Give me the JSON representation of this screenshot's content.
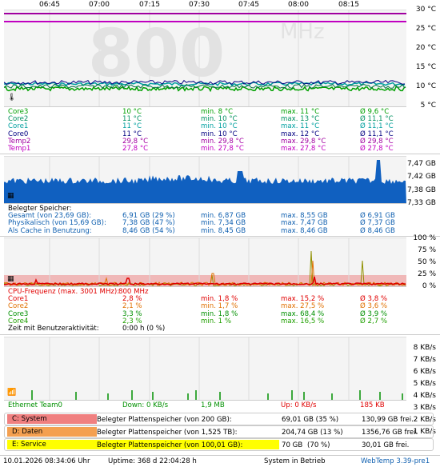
{
  "time_axis": [
    "06:45",
    "07:00",
    "07:15",
    "07:30",
    "07:45",
    "08:00",
    "08:15"
  ],
  "temp_panel": {
    "y_ticks": [
      "30 °C",
      "25 °C",
      "20 °C",
      "15 °C",
      "10 °C",
      "5 °C"
    ],
    "background_text": {
      "value": "800",
      "unit": "MHz"
    },
    "rows": [
      {
        "name": "Core3",
        "cur": "10 °C",
        "min": "min. 8 °C",
        "max": "max. 11 °C",
        "avg": "Ø 9,6 °C",
        "color": "#00a000"
      },
      {
        "name": "Core2",
        "cur": "11 °C",
        "min": "min. 10 °C",
        "max": "max. 13 °C",
        "avg": "Ø 11,1 °C",
        "color": "#009060"
      },
      {
        "name": "Core1",
        "cur": "11 °C",
        "min": "min. 10 °C",
        "max": "max. 11 °C",
        "avg": "Ø 11,1 °C",
        "color": "#00a0a0"
      },
      {
        "name": "Core0",
        "cur": "11 °C",
        "min": "min. 10 °C",
        "max": "max. 12 °C",
        "avg": "Ø 11,1 °C",
        "color": "#000080"
      },
      {
        "name": "Temp2",
        "cur": "29,8 °C",
        "min": "min. 29,8 °C",
        "max": "max. 29,8 °C",
        "avg": "Ø 29,8 °C",
        "color": "#a000a0"
      },
      {
        "name": "Temp1",
        "cur": "27,8 °C",
        "min": "min. 27,8 °C",
        "max": "max. 27,8 °C",
        "avg": "Ø 27,8 °C",
        "color": "#c000c0"
      }
    ]
  },
  "mem_panel": {
    "y_ticks": [
      "7,47 GB",
      "7,42 GB",
      "7,38 GB",
      "7,33 GB"
    ],
    "header": "Belegter Speicher:",
    "rows": [
      {
        "name": "Gesamt (von 23,69 GB):",
        "cur": "6,91 GB (29 %)",
        "min": "min. 6,87 GB",
        "max": "max. 8,55 GB",
        "avg": "Ø 6,91 GB"
      },
      {
        "name": "Physikalisch (von 15,69 GB):",
        "cur": "7,38 GB (47 %)",
        "min": "min. 7,34 GB",
        "max": "max. 7,47 GB",
        "avg": "Ø 7,37 GB"
      },
      {
        "name": "Als Cache in Benutzung:",
        "cur": "8,46 GB (54 %)",
        "min": "min. 8,45 GB",
        "max": "max. 8,46 GB",
        "avg": "Ø 8,46 GB"
      }
    ]
  },
  "cpu_panel": {
    "y_ticks": [
      "100 %",
      "75 %",
      "50 %",
      "25 %",
      "0 %"
    ],
    "freq_label": "CPU-Frequenz (max. 3001 MHz):",
    "freq_value": "800 MHz",
    "rows": [
      {
        "name": "Core1",
        "cur": "2,8 %",
        "min": "min. 1,8 %",
        "max": "max. 15,2 %",
        "avg": "Ø 3,8 %",
        "color": "#e00000"
      },
      {
        "name": "Core2",
        "cur": "2,1 %",
        "min": "min. 1,7 %",
        "max": "max. 27,5 %",
        "avg": "Ø 3,6 %",
        "color": "#e07000"
      },
      {
        "name": "Core3",
        "cur": "3,3 %",
        "min": "min. 1,8 %",
        "max": "max. 68,4 %",
        "avg": "Ø 3,9 %",
        "color": "#009000"
      },
      {
        "name": "Core4",
        "cur": "2,3 %",
        "min": "min. 1 %",
        "max": "max. 16,5 %",
        "avg": "Ø 2,7 %",
        "color": "#20a000"
      }
    ],
    "activity_label": "Zeit mit Benutzeraktivität:",
    "activity_value": "0:00 h (0 %)"
  },
  "net_panel": {
    "y_ticks": [
      "8 KB/s",
      "7 KB/s",
      "6 KB/s",
      "5 KB/s",
      "4 KB/s",
      "3 KB/s",
      "2 KB/s",
      "1 KB/s"
    ],
    "name": "Ethernet Team0",
    "down": "Down: 0 KB/s",
    "down_total": "1,9 MB",
    "up": "Up: 0 KB/s",
    "up_total": "185 KB"
  },
  "drives": [
    {
      "name": "C: System",
      "label": "Belegter Plattenspeicher (von 200 GB):",
      "used": "69,01 GB (35 %)",
      "free": "130,99 GB frei.",
      "color": "#f08080",
      "fill_fraction": 0.35
    },
    {
      "name": "D: Daten",
      "label": "Belegter Plattenspeicher (von 1,525 TB):",
      "used": "204,74 GB (13 %)",
      "free": "1356,76 GB frei.",
      "color": "#f4a050",
      "fill_fraction": 0.13
    },
    {
      "name": "E: Service",
      "label": "Belegter Plattenspeicher (von 100,01 GB):",
      "used": "70 GB",
      "used_pct": "(70 %)",
      "free": "30,01 GB frei.",
      "color": "#ffff00",
      "fill_fraction": 0.7
    }
  ],
  "status": {
    "datetime": "10.01.2026 08:34:06 Uhr",
    "uptime": "Uptime: 368 d 22:04:28 h",
    "state": "System in Betrieb",
    "version": "WebTemp 3.39-pre1"
  }
}
